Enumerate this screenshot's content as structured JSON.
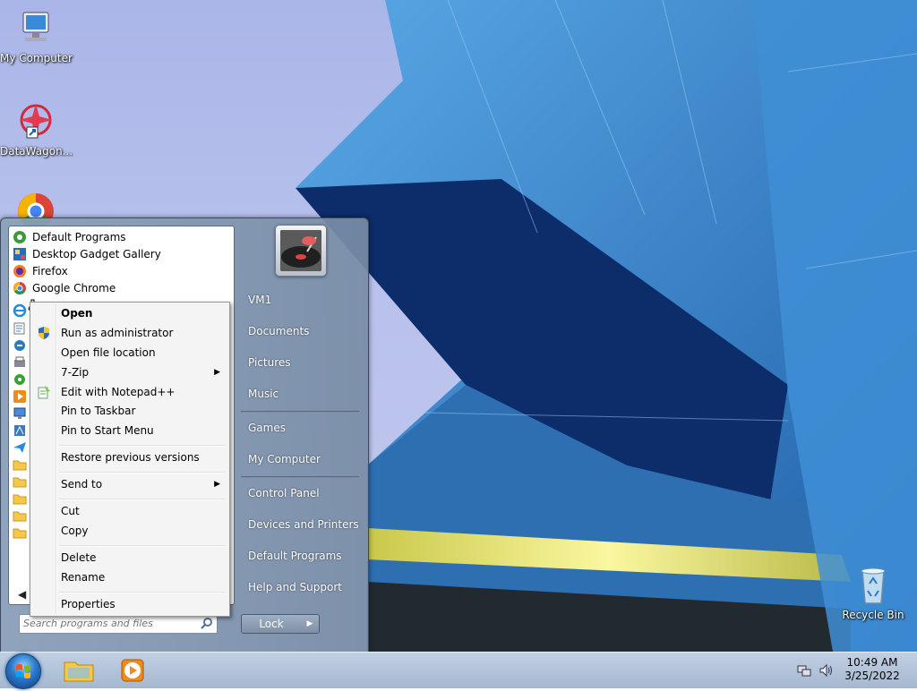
{
  "desktop": {
    "icons": [
      {
        "label": "My Computer",
        "icon": "computer-icon"
      },
      {
        "label": "DataWagon...",
        "icon": "datawagon-icon"
      },
      {
        "label": "Google Chrome",
        "icon": "chrome-icon"
      },
      {
        "label": "Recycle Bin",
        "icon": "recycle-bin-icon"
      }
    ]
  },
  "start_menu": {
    "programs": [
      {
        "label": "Default Programs",
        "icon": "default-programs-icon"
      },
      {
        "label": "Desktop Gadget Gallery",
        "icon": "gadget-gallery-icon"
      },
      {
        "label": "Firefox",
        "icon": "firefox-icon"
      },
      {
        "label": "Google Chrome",
        "icon": "chrome-icon"
      }
    ],
    "back_label": "◀",
    "search": {
      "placeholder": "Search programs and files"
    },
    "right_items": {
      "user": "VM1",
      "documents": "Documents",
      "pictures": "Pictures",
      "music": "Music",
      "games": "Games",
      "my_computer": "My Computer",
      "control_panel": "Control Panel",
      "devices_printers": "Devices and Printers",
      "default_programs": "Default Programs",
      "help_support": "Help and Support"
    },
    "lock_label": "Lock",
    "lock_arrow": "▶"
  },
  "context_menu": {
    "items": {
      "open": "Open",
      "run_admin": "Run as administrator",
      "open_location": "Open file location",
      "zip": "7-Zip",
      "notepad": "Edit with Notepad++",
      "pin_taskbar": "Pin to Taskbar",
      "pin_start": "Pin to Start Menu",
      "restore": "Restore previous versions",
      "send_to": "Send to",
      "cut": "Cut",
      "copy": "Copy",
      "delete": "Delete",
      "rename": "Rename",
      "properties": "Properties"
    },
    "submenu_arrow": "▶"
  },
  "taskbar": {
    "clock_time": "10:49 AM",
    "clock_date": "3/25/2022"
  },
  "colors": {
    "accent": "#2a78c8",
    "menu_bg": "#f4f4f4"
  }
}
